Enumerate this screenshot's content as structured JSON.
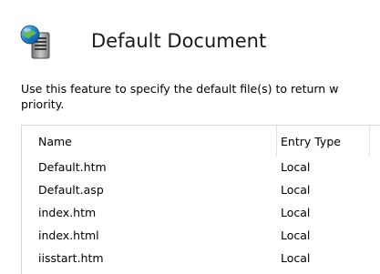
{
  "feature": {
    "icon": "default-document-server-icon",
    "title": "Default Document",
    "description_lines": [
      "Use this feature to specify the default file(s) to return w",
      "priority."
    ]
  },
  "grid": {
    "columns": [
      "Name",
      "Entry Type"
    ],
    "rows": [
      {
        "name": "Default.htm",
        "entry_type": "Local"
      },
      {
        "name": "Default.asp",
        "entry_type": "Local"
      },
      {
        "name": "index.htm",
        "entry_type": "Local"
      },
      {
        "name": "index.html",
        "entry_type": "Local"
      },
      {
        "name": "iisstart.htm",
        "entry_type": "Local"
      }
    ]
  }
}
